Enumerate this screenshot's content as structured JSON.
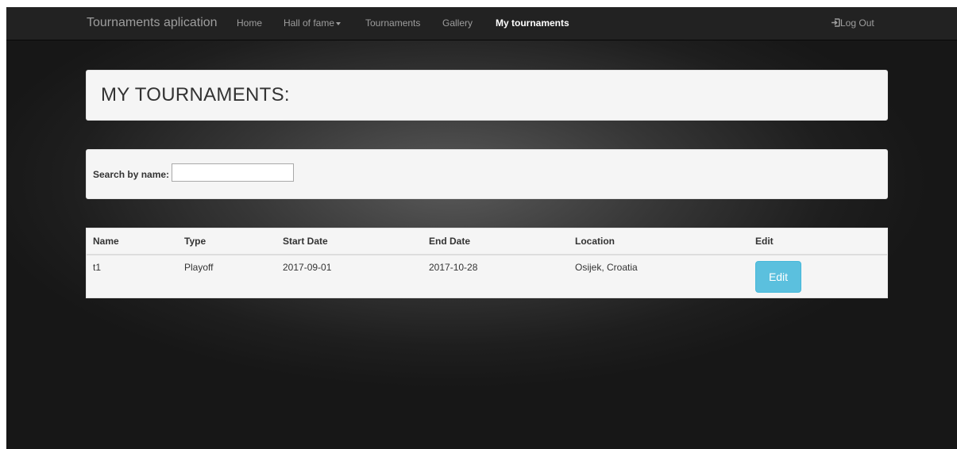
{
  "navbar": {
    "brand": "Tournaments aplication",
    "items": [
      {
        "label": "Home"
      },
      {
        "label": "Hall of fame"
      },
      {
        "label": "Tournaments"
      },
      {
        "label": "Gallery"
      },
      {
        "label": "My tournaments",
        "active": true
      }
    ],
    "logout_label": "Log Out",
    "logout_icon": "log-in-icon"
  },
  "page": {
    "title": "MY TOURNAMENTS:"
  },
  "search": {
    "label": "Search by name:",
    "value": "",
    "placeholder": ""
  },
  "table": {
    "columns": [
      "Name",
      "Type",
      "Start Date",
      "End Date",
      "Location",
      "Edit"
    ],
    "rows": [
      {
        "name": "t1",
        "type": "Playoff",
        "start_date": "2017-09-01",
        "end_date": "2017-10-28",
        "location": "Osijek, Croatia",
        "edit_label": "Edit"
      }
    ]
  },
  "colors": {
    "navbar_bg": "#222222",
    "panel_bg": "#f5f5f5",
    "edit_button": "#5bc0de"
  }
}
